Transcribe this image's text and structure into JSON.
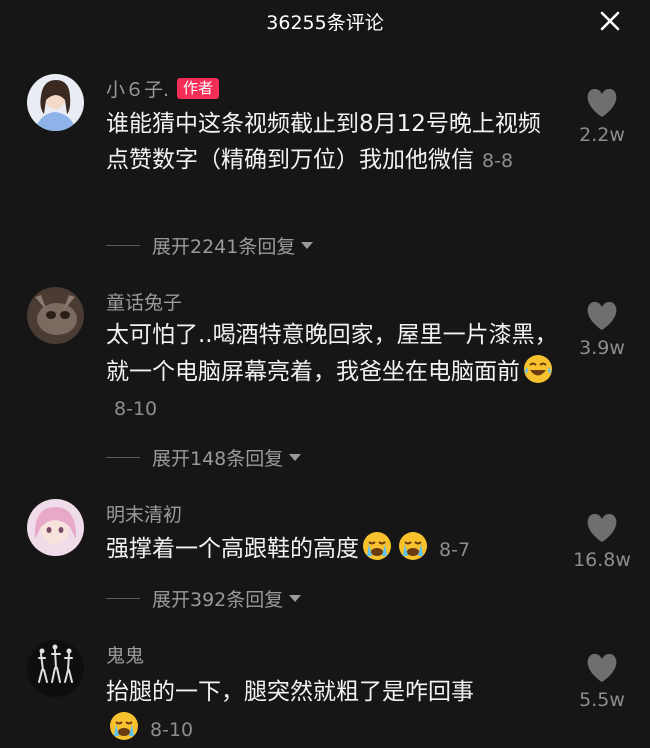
{
  "header": {
    "title": "36255条评论",
    "close_icon": "close-icon"
  },
  "comments": [
    {
      "username": "小６子.",
      "badge": "作者",
      "text": "谁能猜中这条视频截止到8月12号晚上视频点赞数字（精确到万位）我加他微信",
      "date": "8-8",
      "likes": "2.2w",
      "replies": "展开2241条回复",
      "emojis": []
    },
    {
      "username": "童话兔子",
      "text": "太可怕了..喝酒特意晚回家，屋里一片漆黑，就一个电脑屏幕亮着，我爸坐在电脑面前",
      "date": "8-10",
      "likes": "3.9w",
      "replies": "展开148条回复",
      "emojis": [
        "laugh-crying-emoji"
      ]
    },
    {
      "username": "明末清初",
      "text": "强撑着一个高跟鞋的高度",
      "date": "8-7",
      "likes": "16.8w",
      "replies": "展开392条回复",
      "emojis": [
        "crying-emoji",
        "crying-emoji"
      ]
    },
    {
      "username": "鬼鬼",
      "text": "抬腿的一下，腿突然就粗了是咋回事",
      "date": "8-10",
      "likes": "5.5w",
      "emojis": [
        "crying-emoji"
      ]
    }
  ],
  "colors": {
    "background": "#161616",
    "badge": "#f42e57",
    "secondary_text": "#9a9a9a"
  }
}
